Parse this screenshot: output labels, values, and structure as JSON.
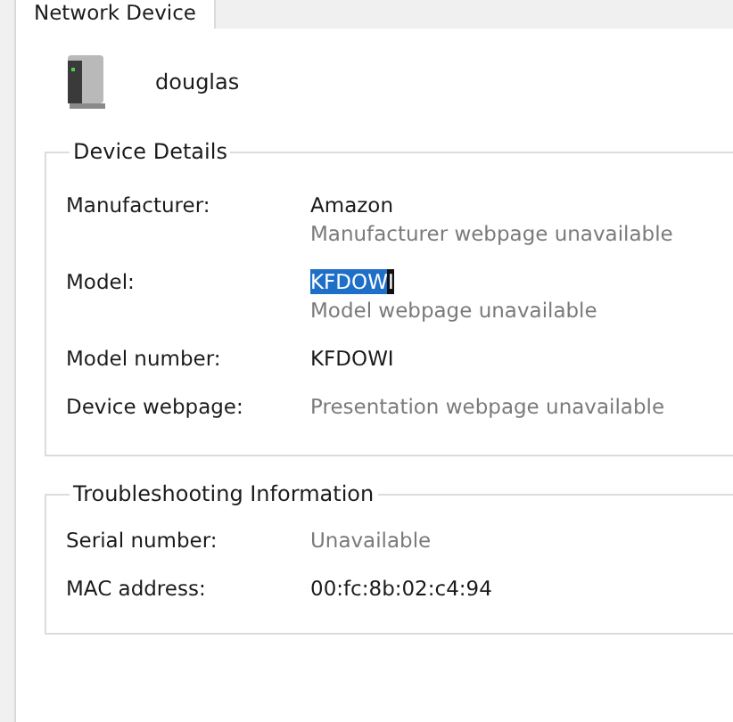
{
  "tabs": [
    {
      "label": "Network Device"
    }
  ],
  "device": {
    "name": "douglas"
  },
  "groups": [
    {
      "title": "Device Details",
      "rows": [
        {
          "label": "Manufacturer:",
          "value": "Amazon",
          "value_dimmed": false,
          "note": "Manufacturer webpage unavailable"
        },
        {
          "label": "Model:",
          "value_selected": "KFDOW",
          "value": "I",
          "note": "Model webpage unavailable"
        },
        {
          "label": "Model number:",
          "value": "KFDOWI",
          "value_dimmed": false
        },
        {
          "label": "Device webpage:",
          "value": "Presentation webpage unavailable",
          "value_dimmed": true
        }
      ]
    },
    {
      "title": "Troubleshooting Information",
      "rows": [
        {
          "label": "Serial number:",
          "value": "Unavailable",
          "value_dimmed": true
        },
        {
          "label": "MAC address:",
          "value": "00:fc:8b:02:c4:94",
          "value_dimmed": false
        }
      ]
    }
  ]
}
